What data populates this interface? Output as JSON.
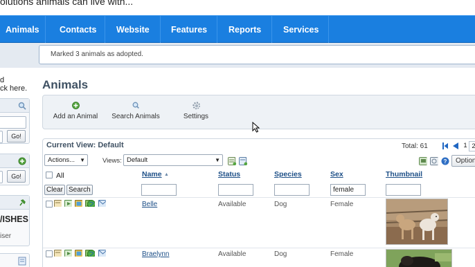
{
  "header": {
    "tagline": "olutions animals can live with..."
  },
  "nav": {
    "items": [
      "Animals",
      "Contacts",
      "Website",
      "Features",
      "Reports",
      "Services"
    ]
  },
  "notice": {
    "text": "Marked 3 animals as adopted."
  },
  "sidebar": {
    "intro_line1": "d",
    "intro_line2": "ck here.",
    "go_label": "Go!",
    "wishes_title": "/ISHES",
    "wishes_sub": "iser"
  },
  "page": {
    "title": "Animals"
  },
  "toolbar": {
    "add_label": "Add an Animal",
    "search_label": "Search Animals",
    "settings_label": "Settings"
  },
  "list": {
    "current_view": "Current View: Default",
    "total": "Total: 61",
    "page_current": "1",
    "page_next": "2",
    "actions": "Actions...",
    "views_label": "Views:",
    "views_value": "Default",
    "options": "Option",
    "all_label": "All",
    "clear": "Clear",
    "search": "Search",
    "columns": {
      "name": "Name",
      "status": "Status",
      "species": "Species",
      "sex": "Sex",
      "thumbnail": "Thumbnail"
    },
    "filters": {
      "name": "",
      "status": "",
      "species": "",
      "sex": "female",
      "thumbnail": ""
    },
    "sort_indicator": "▲",
    "rows": [
      {
        "name": "Belle",
        "status": "Available",
        "species": "Dog",
        "sex": "Female"
      },
      {
        "name": "Braelynn",
        "status": "Available",
        "species": "Dog",
        "sex": "Female"
      }
    ]
  },
  "colors": {
    "nav": "#1a7fe0",
    "title": "#3f5163",
    "link": "#1d4f87"
  }
}
